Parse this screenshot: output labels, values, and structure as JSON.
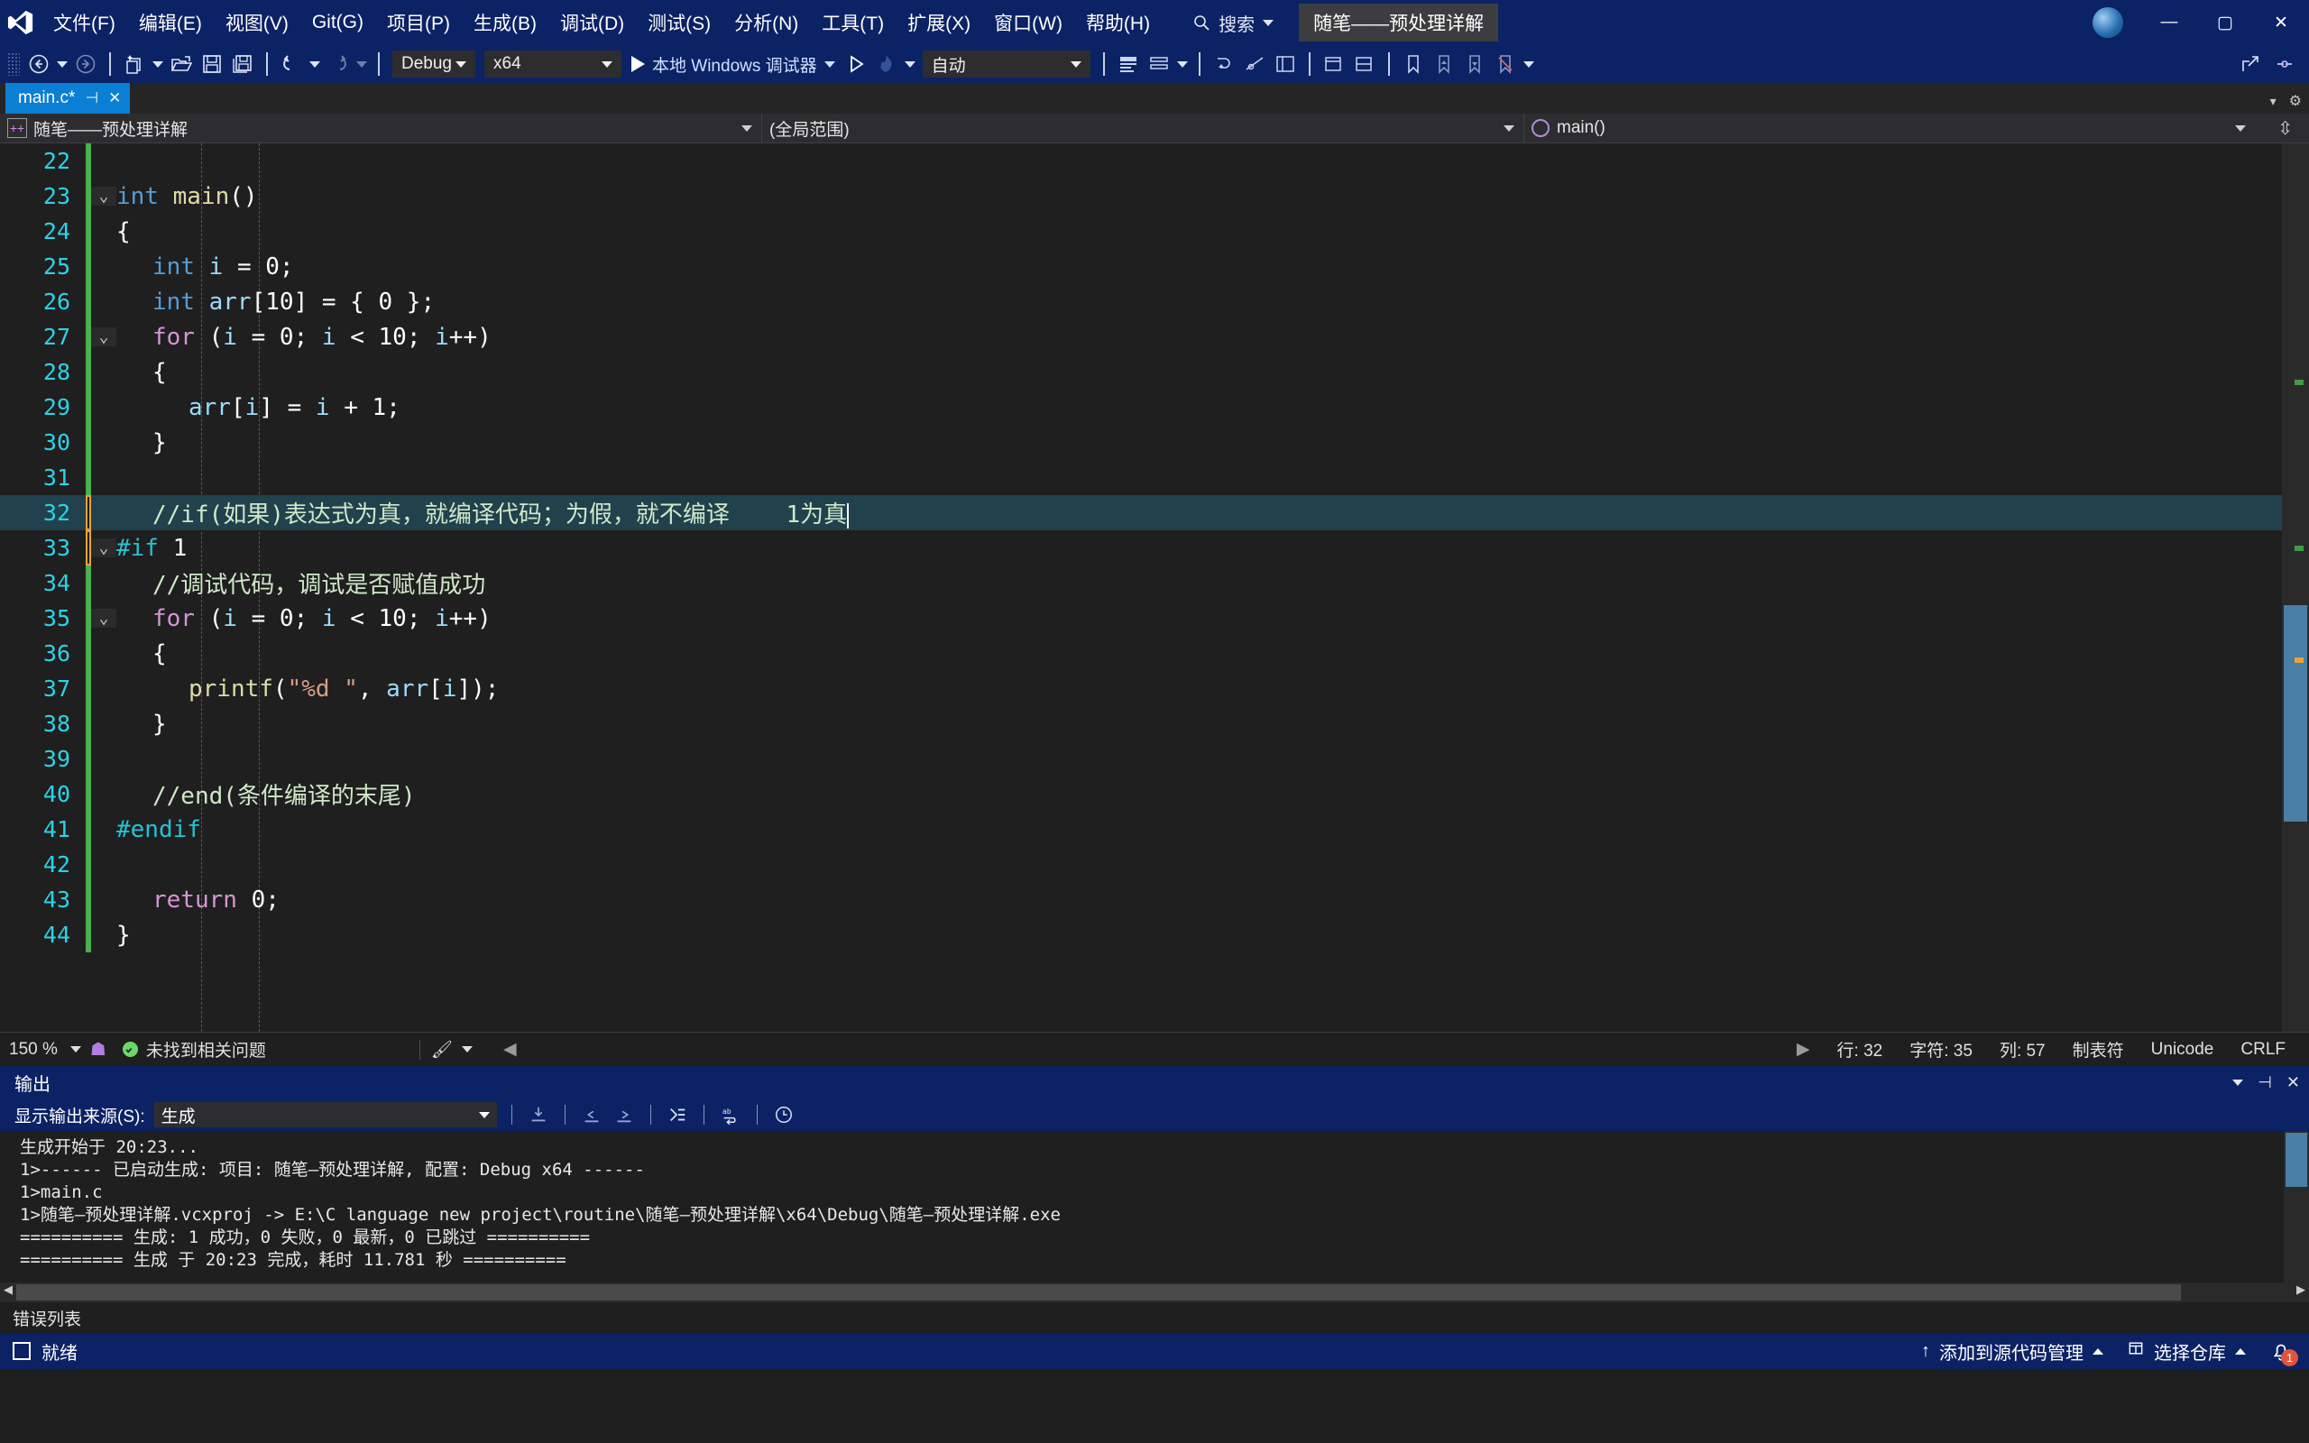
{
  "app": {
    "title": "Microsoft Visual Studio",
    "solution_name": "随笔——预处理详解"
  },
  "menubar": {
    "items": [
      "文件(F)",
      "编辑(E)",
      "视图(V)",
      "Git(G)",
      "项目(P)",
      "生成(B)",
      "调试(D)",
      "测试(S)",
      "分析(N)",
      "工具(T)",
      "扩展(X)",
      "窗口(W)",
      "帮助(H)"
    ],
    "search_placeholder": "搜索",
    "window_buttons": {
      "minimize": "—",
      "maximize": "▢",
      "close": "✕"
    }
  },
  "toolbar": {
    "config": "Debug",
    "platform": "x64",
    "run_label": "本地 Windows 调试器",
    "auto": "自动"
  },
  "tabs": [
    {
      "label": "main.c*",
      "pin": "⊣",
      "close": "✕",
      "active": true
    }
  ],
  "navbar": {
    "project": "随笔——预处理详解",
    "scope": "(全局范围)",
    "function": "main()"
  },
  "editor": {
    "first_line": 22,
    "lines": [
      {
        "n": 22,
        "bar": "green",
        "fold": "",
        "indent": 0,
        "tokens": []
      },
      {
        "n": 23,
        "bar": "green",
        "fold": "v",
        "indent": 0,
        "tokens": [
          {
            "t": "int",
            "c": "t-key"
          },
          {
            "t": " ",
            "c": "t-punct"
          },
          {
            "t": "main",
            "c": "t-fn"
          },
          {
            "t": "()",
            "c": "t-punct"
          }
        ]
      },
      {
        "n": 24,
        "bar": "green",
        "fold": "",
        "indent": 0,
        "tokens": [
          {
            "t": "{",
            "c": "t-punct"
          }
        ]
      },
      {
        "n": 25,
        "bar": "green",
        "fold": "",
        "indent": 1,
        "tokens": [
          {
            "t": "int",
            "c": "t-key"
          },
          {
            "t": " i ",
            "c": "t-var"
          },
          {
            "t": "= ",
            "c": "t-punct"
          },
          {
            "t": "0",
            "c": "t-num"
          },
          {
            "t": ";",
            "c": "t-punct"
          }
        ]
      },
      {
        "n": 26,
        "bar": "green",
        "fold": "",
        "indent": 1,
        "tokens": [
          {
            "t": "int",
            "c": "t-key"
          },
          {
            "t": " arr",
            "c": "t-var"
          },
          {
            "t": "[",
            "c": "t-punct"
          },
          {
            "t": "10",
            "c": "t-num"
          },
          {
            "t": "] = { ",
            "c": "t-punct"
          },
          {
            "t": "0",
            "c": "t-num"
          },
          {
            "t": " };",
            "c": "t-punct"
          }
        ]
      },
      {
        "n": 27,
        "bar": "green",
        "fold": "v",
        "indent": 1,
        "tokens": [
          {
            "t": "for",
            "c": "t-kw2"
          },
          {
            "t": " (",
            "c": "t-punct"
          },
          {
            "t": "i ",
            "c": "t-var"
          },
          {
            "t": "= ",
            "c": "t-punct"
          },
          {
            "t": "0",
            "c": "t-num"
          },
          {
            "t": "; ",
            "c": "t-punct"
          },
          {
            "t": "i ",
            "c": "t-var"
          },
          {
            "t": "< ",
            "c": "t-punct"
          },
          {
            "t": "10",
            "c": "t-num"
          },
          {
            "t": "; ",
            "c": "t-punct"
          },
          {
            "t": "i",
            "c": "t-var"
          },
          {
            "t": "++)",
            "c": "t-punct"
          }
        ]
      },
      {
        "n": 28,
        "bar": "green",
        "fold": "",
        "indent": 1,
        "tokens": [
          {
            "t": "{",
            "c": "t-punct"
          }
        ]
      },
      {
        "n": 29,
        "bar": "green",
        "fold": "",
        "indent": 2,
        "tokens": [
          {
            "t": "arr",
            "c": "t-var"
          },
          {
            "t": "[",
            "c": "t-punct"
          },
          {
            "t": "i",
            "c": "t-var"
          },
          {
            "t": "] = ",
            "c": "t-punct"
          },
          {
            "t": "i ",
            "c": "t-var"
          },
          {
            "t": "+ ",
            "c": "t-punct"
          },
          {
            "t": "1",
            "c": "t-num"
          },
          {
            "t": ";",
            "c": "t-punct"
          }
        ]
      },
      {
        "n": 30,
        "bar": "green",
        "fold": "",
        "indent": 1,
        "tokens": [
          {
            "t": "}",
            "c": "t-punct"
          }
        ]
      },
      {
        "n": 31,
        "bar": "green",
        "fold": "",
        "indent": 1,
        "tokens": []
      },
      {
        "n": 32,
        "bar": "orange",
        "fold": "",
        "indent": 1,
        "highlight": true,
        "cursor": true,
        "tokens": [
          {
            "t": "//if(如果)表达式为真，就编译代码；为假，就不编译    1为真",
            "c": "t-cmt"
          }
        ]
      },
      {
        "n": 33,
        "bar": "orange",
        "fold": "v",
        "indent": 0,
        "tokens": [
          {
            "t": "#if",
            "c": "t-pp"
          },
          {
            "t": " ",
            "c": "t-punct"
          },
          {
            "t": "1",
            "c": "t-ppnum"
          }
        ]
      },
      {
        "n": 34,
        "bar": "green",
        "fold": "",
        "indent": 1,
        "tokens": [
          {
            "t": "//调试代码，调试是否赋值成功",
            "c": "t-cmt"
          }
        ]
      },
      {
        "n": 35,
        "bar": "green",
        "fold": "v",
        "indent": 1,
        "tokens": [
          {
            "t": "for",
            "c": "t-kw2"
          },
          {
            "t": " (",
            "c": "t-punct"
          },
          {
            "t": "i ",
            "c": "t-var"
          },
          {
            "t": "= ",
            "c": "t-punct"
          },
          {
            "t": "0",
            "c": "t-num"
          },
          {
            "t": "; ",
            "c": "t-punct"
          },
          {
            "t": "i ",
            "c": "t-var"
          },
          {
            "t": "< ",
            "c": "t-punct"
          },
          {
            "t": "10",
            "c": "t-num"
          },
          {
            "t": "; ",
            "c": "t-punct"
          },
          {
            "t": "i",
            "c": "t-var"
          },
          {
            "t": "++)",
            "c": "t-punct"
          }
        ]
      },
      {
        "n": 36,
        "bar": "green",
        "fold": "",
        "indent": 1,
        "tokens": [
          {
            "t": "{",
            "c": "t-punct"
          }
        ]
      },
      {
        "n": 37,
        "bar": "green",
        "fold": "",
        "indent": 2,
        "tokens": [
          {
            "t": "printf",
            "c": "t-fn"
          },
          {
            "t": "(",
            "c": "t-punct"
          },
          {
            "t": "\"%d \"",
            "c": "t-str"
          },
          {
            "t": ", ",
            "c": "t-punct"
          },
          {
            "t": "arr",
            "c": "t-var"
          },
          {
            "t": "[",
            "c": "t-punct"
          },
          {
            "t": "i",
            "c": "t-var"
          },
          {
            "t": "]);",
            "c": "t-punct"
          }
        ]
      },
      {
        "n": 38,
        "bar": "green",
        "fold": "",
        "indent": 1,
        "tokens": [
          {
            "t": "}",
            "c": "t-punct"
          }
        ]
      },
      {
        "n": 39,
        "bar": "green",
        "fold": "",
        "indent": 1,
        "tokens": []
      },
      {
        "n": 40,
        "bar": "green",
        "fold": "",
        "indent": 1,
        "tokens": [
          {
            "t": "//end(条件编译的末尾)",
            "c": "t-cmt"
          }
        ]
      },
      {
        "n": 41,
        "bar": "green",
        "fold": "",
        "indent": 0,
        "tokens": [
          {
            "t": "#endif",
            "c": "t-pp"
          }
        ]
      },
      {
        "n": 42,
        "bar": "green",
        "fold": "",
        "indent": 1,
        "tokens": []
      },
      {
        "n": 43,
        "bar": "green",
        "fold": "",
        "indent": 1,
        "tokens": [
          {
            "t": "return",
            "c": "t-kw2"
          },
          {
            "t": " ",
            "c": "t-punct"
          },
          {
            "t": "0",
            "c": "t-num"
          },
          {
            "t": ";",
            "c": "t-punct"
          }
        ]
      },
      {
        "n": 44,
        "bar": "green",
        "fold": "",
        "indent": 0,
        "tokens": [
          {
            "t": "}",
            "c": "t-punct"
          }
        ]
      }
    ]
  },
  "editor_status": {
    "zoom": "150 %",
    "problems": "未找到相关问题",
    "line_label": "行: 32",
    "char_label": "字符: 35",
    "col_label": "列: 57",
    "tab_label": "制表符",
    "encoding": "Unicode",
    "eol": "CRLF"
  },
  "output": {
    "title": "输出",
    "source_label": "显示输出来源(S):",
    "source_value": "生成",
    "lines": [
      "生成开始于 20:23...",
      "1>------ 已启动生成: 项目: 随笔—预处理详解, 配置: Debug x64 ------",
      "1>main.c",
      "1>随笔—预处理详解.vcxproj -> E:\\C language new project\\routine\\随笔—预处理详解\\x64\\Debug\\随笔—预处理详解.exe",
      "========== 生成: 1 成功，0 失败，0 最新，0 已跳过 ==========",
      "========== 生成 于 20:23 完成，耗时 11.781 秒 =========="
    ],
    "error_list_tab": "错误列表"
  },
  "statusbar": {
    "ready": "就绪",
    "source_control": "添加到源代码管理",
    "repo": "选择仓库",
    "notification_count": "1"
  },
  "colors": {
    "chrome_blue": "#0b2265",
    "tab_active": "#0a7fd4",
    "editor_bg": "#1f1f1f",
    "line_number": "#2bd3e8",
    "comment": "#cfe8c8",
    "keyword": "#569cd6",
    "control_keyword": "#d497d3",
    "function": "#dcdcaa",
    "string": "#d69d85",
    "preprocessor": "#25c3d6",
    "changebar_saved": "#4caf50",
    "changebar_unsaved": "#e9a33a",
    "highlight_line": "#21414d"
  }
}
